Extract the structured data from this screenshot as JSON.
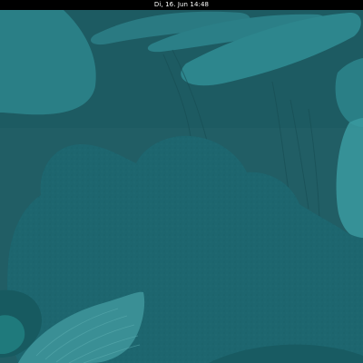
{
  "topbar": {
    "clock_text": "Di, 16. Jun  14:48"
  },
  "wallpaper": {
    "base_color": "#1f5f66",
    "leaf_light": "#2b8087",
    "leaf_mid": "#2a7078",
    "bush_color": "#1d666f",
    "sky_color": "#235d63"
  }
}
